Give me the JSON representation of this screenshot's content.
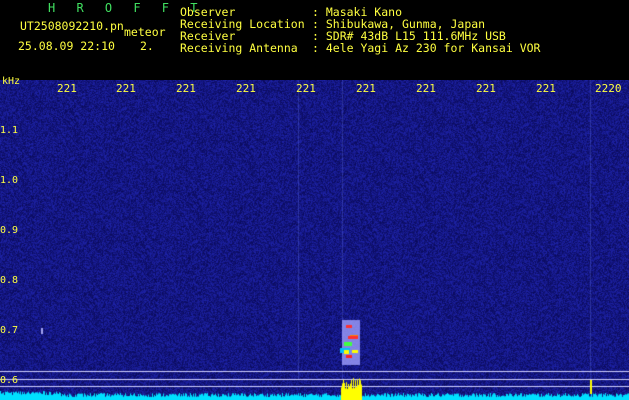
{
  "header": {
    "program": "H R O F F T",
    "filename": "UT2508092210.pn",
    "event_type": "meteor",
    "datetime": "25.08.09 22:10",
    "index": "2.",
    "info": [
      {
        "label": "Observer",
        "value": ": Masaki Kano"
      },
      {
        "label": "Receiving Location",
        "value": ": Shibukawa, Gunma, Japan"
      },
      {
        "label": "Receiver",
        "value": ": SDR# 43dB L15 111.6MHz USB"
      },
      {
        "label": "Receiving Antenna",
        "value": ": 4ele Yagi Az 230 for Kansai VOR"
      }
    ]
  },
  "spectrogram": {
    "y_unit": "kHz",
    "y_ticks": [
      "1.1",
      "1.0",
      "0.9",
      "0.8",
      "0.7",
      "0.6"
    ],
    "x_ticks": [
      "221",
      "221",
      "221",
      "221",
      "221",
      "221",
      "221",
      "221",
      "221",
      "2220"
    ],
    "colors": {
      "background": "#10107a",
      "trace": "#00e0ff",
      "burst": "#ffff00",
      "lines": "#d0d0ff"
    }
  }
}
